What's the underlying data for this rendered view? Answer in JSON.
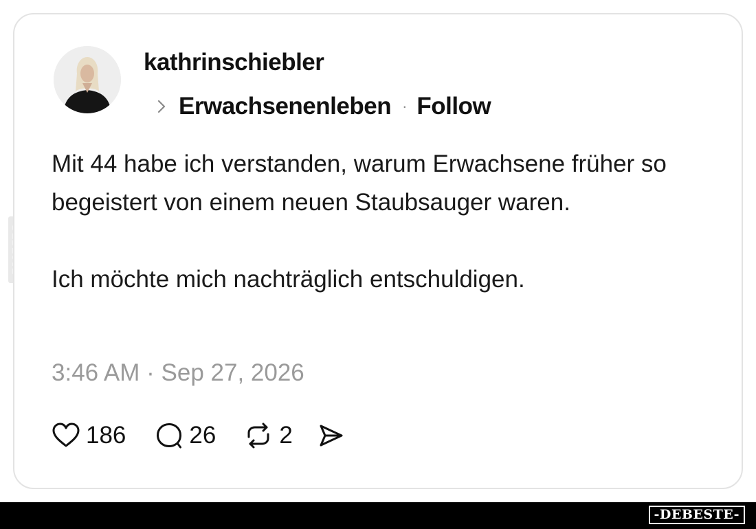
{
  "post": {
    "username": "kathrinschiebler",
    "topic": "Erwachsenenleben",
    "separator": "·",
    "follow_label": "Follow",
    "body": [
      "Mit 44 habe ich verstanden, warum Erwachsene früher so begeistert von einem neuen Staubsauger waren.",
      "Ich möchte mich nachträglich entschuldigen."
    ],
    "timestamp": "3:46 AM · Sep 27, 2026",
    "actions": {
      "likes": "186",
      "replies": "26",
      "reposts": "2"
    },
    "icons": {
      "topic": "chevron-right-icon",
      "like": "heart-icon",
      "reply": "comment-bubble-icon",
      "repost": "repost-icon",
      "share": "send-icon"
    }
  },
  "watermark": {
    "side_text": "DEBESTE",
    "brand": "-DEBESTE-"
  },
  "colors": {
    "text": "#111111",
    "muted": "#9a9a9a",
    "card_border": "#e3e3e3",
    "footer_bar": "#000000"
  }
}
